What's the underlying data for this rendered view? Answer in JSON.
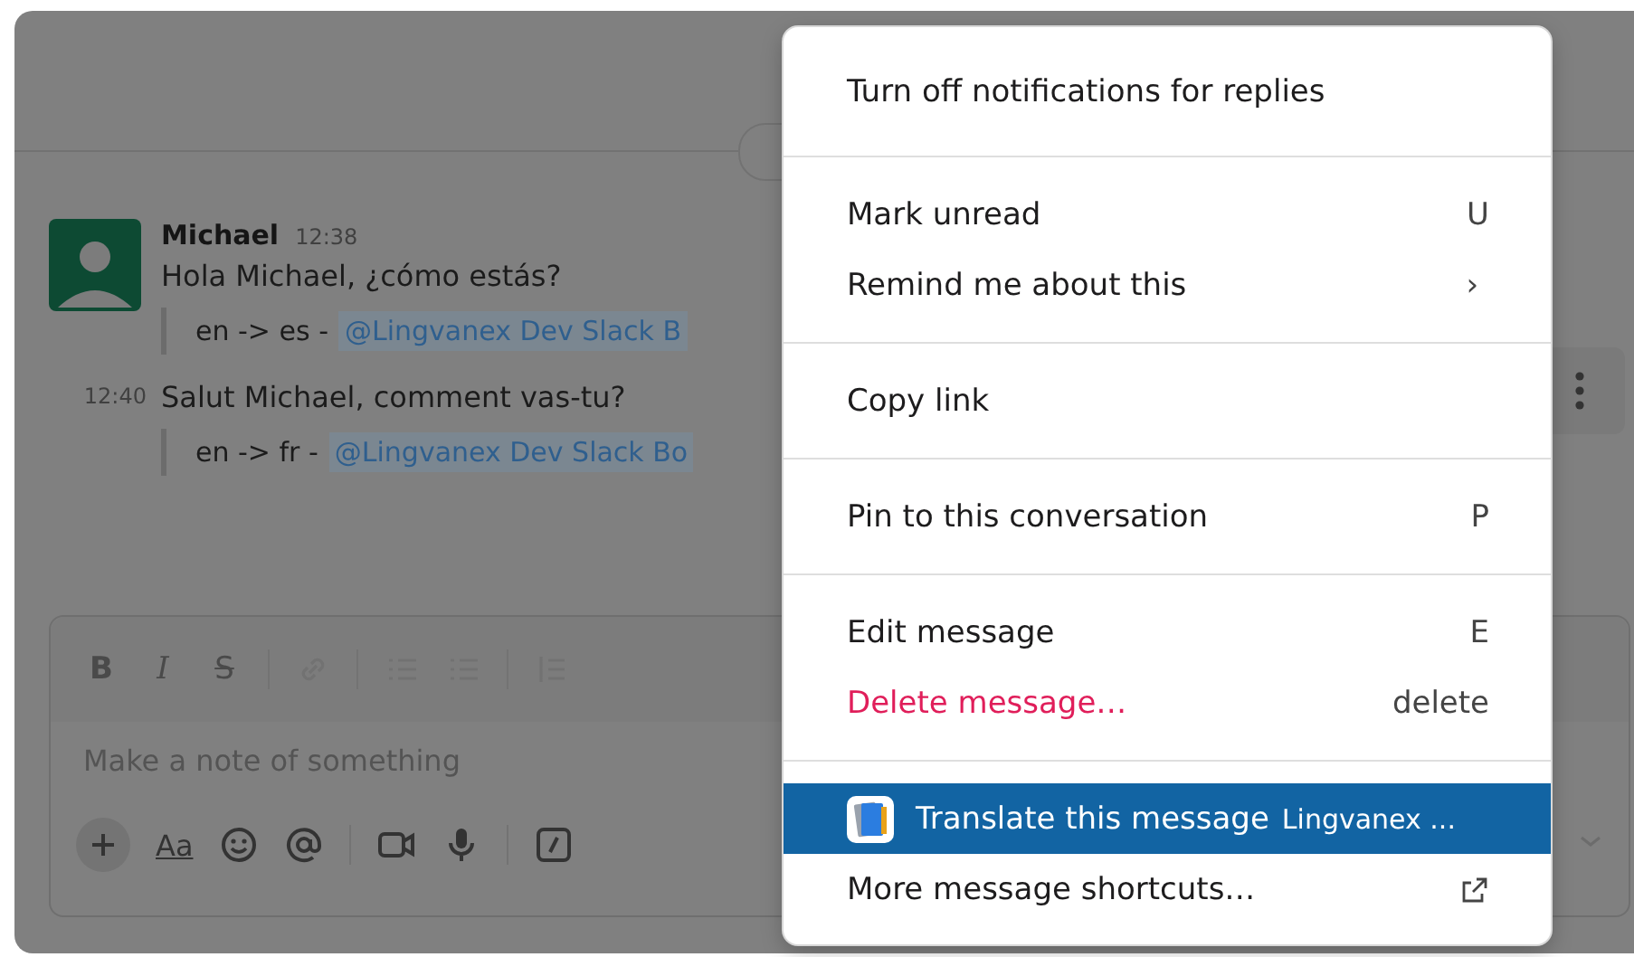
{
  "conversation": {
    "messages": [
      {
        "author": "Michael",
        "time": "12:38",
        "text": "Hola Michael, ¿cómo estás?",
        "quote": {
          "prefix": "en -> es -",
          "mention": "@Lingvanex Dev Slack B"
        }
      },
      {
        "time": "12:40",
        "text": "Salut Michael, comment vas-tu?",
        "quote": {
          "prefix": "en -> fr -",
          "mention": "@Lingvanex Dev Slack Bo"
        }
      }
    ]
  },
  "composer": {
    "format_groups": [
      [
        {
          "kind": "bold",
          "label": "B"
        },
        {
          "kind": "italic",
          "label": "I"
        },
        {
          "kind": "strike",
          "label": "S"
        }
      ],
      [
        {
          "kind": "link"
        }
      ],
      [
        {
          "kind": "ordered-list"
        },
        {
          "kind": "bullet-list"
        }
      ],
      [
        {
          "kind": "quote"
        }
      ]
    ],
    "placeholder": "Make a note of something",
    "action_groups": [
      [
        {
          "kind": "plus"
        },
        {
          "kind": "text-format",
          "label": "Aa"
        },
        {
          "kind": "emoji"
        },
        {
          "kind": "mention"
        }
      ],
      [
        {
          "kind": "video"
        },
        {
          "kind": "mic"
        }
      ],
      [
        {
          "kind": "slash"
        }
      ]
    ]
  },
  "context_menu": {
    "sections": [
      [
        {
          "kind": "plain",
          "label": "Turn off notifications for replies",
          "selected": false
        }
      ],
      [
        {
          "kind": "shortcut",
          "label": "Mark unread",
          "shortcut": "U",
          "selected": false
        },
        {
          "kind": "submenu",
          "label": "Remind me about this",
          "shortcut": "›",
          "selected": false
        }
      ],
      [
        {
          "kind": "plain",
          "label": "Copy link",
          "selected": false
        }
      ],
      [
        {
          "kind": "shortcut",
          "label": "Pin to this conversation",
          "shortcut": "P",
          "selected": false
        }
      ],
      [
        {
          "kind": "shortcut",
          "label": "Edit message",
          "shortcut": "E",
          "selected": false
        },
        {
          "kind": "danger",
          "label": "Delete message…",
          "shortcut": "delete",
          "selected": false
        }
      ],
      [
        {
          "kind": "app",
          "label": "Translate this message",
          "app": "Lingvanex ...",
          "selected": true
        },
        {
          "kind": "external",
          "label": "More message shortcuts…",
          "selected": false
        }
      ]
    ]
  }
}
